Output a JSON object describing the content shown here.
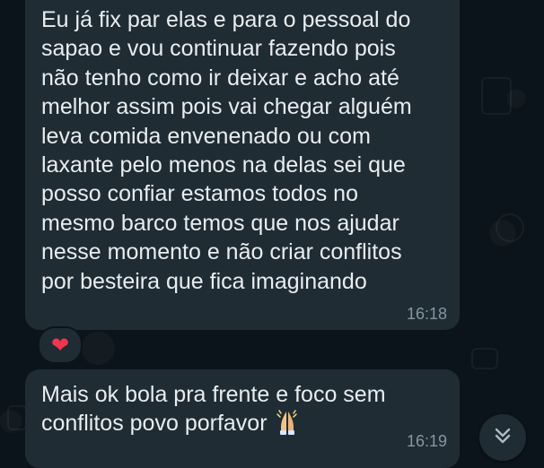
{
  "colors": {
    "background": "#0b141a",
    "bubble": "#1f2c34",
    "text": "#e9edef",
    "timestamp": "#8696a0",
    "reaction_heart": "#f3344d"
  },
  "messages": [
    {
      "text": "Eu já fix par elas e para o pessoal do\nsapao e vou continuar fazendo pois\nnão tenho como ir deixar e acho até\nmelhor assim pois vai chegar alguém\nleva comida envenenado ou com\nlaxante pelo menos na delas sei que\nposso confiar estamos todos no\nmesmo barco temos que nos ajudar\nnesse momento e não criar conflitos\npor besteira que fica imaginando",
      "time": "16:18",
      "reaction_icon": "red-heart-icon"
    },
    {
      "text": "Mais ok bola pra frente e foco sem\nconflitos povo porfavor",
      "emoji_icon": "folded-hands-icon",
      "time": "16:19"
    }
  ],
  "scroll_button_icon": "double-chevron-down-icon"
}
